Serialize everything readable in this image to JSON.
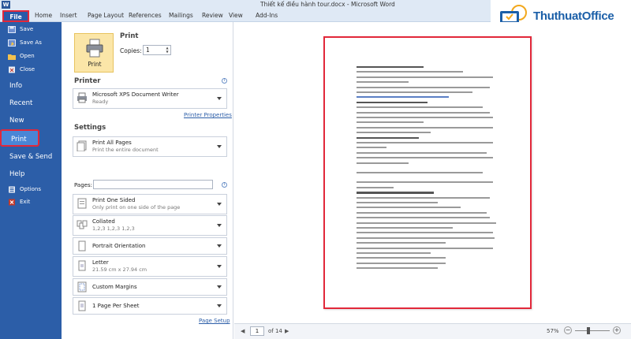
{
  "window": {
    "title": "Thiết kế điều hành tour.docx - Microsoft Word",
    "app_icon": "W"
  },
  "ribbon": {
    "file_tab": "File",
    "tabs": [
      "Home",
      "Insert",
      "Page Layout",
      "References",
      "Mailings",
      "Review",
      "View",
      "Add-Ins"
    ]
  },
  "logo": {
    "title": "ThuthuatOffice",
    "subtitle": "TRÍ KỶ CỦA DÂN CÔNG SỞ"
  },
  "file_menu": {
    "save": "Save",
    "save_as": "Save As",
    "open": "Open",
    "close": "Close",
    "info": "Info",
    "recent": "Recent",
    "new": "New",
    "print": "Print",
    "save_send": "Save & Send",
    "help": "Help",
    "options": "Options",
    "exit": "Exit"
  },
  "print_panel": {
    "heading": "Print",
    "print_button": "Print",
    "copies_label": "Copies:",
    "copies_value": "1",
    "printer_heading": "Printer",
    "printer_name": "Microsoft XPS Document Writer",
    "printer_status": "Ready",
    "printer_properties": "Printer Properties",
    "settings_heading": "Settings",
    "print_all_title": "Print All Pages",
    "print_all_sub": "Print the entire document",
    "pages_label": "Pages:",
    "one_sided_title": "Print One Sided",
    "one_sided_sub": "Only print on one side of the page",
    "collated_title": "Collated",
    "collated_sub": "1,2,3    1,2,3    1,2,3",
    "orientation": "Portrait Orientation",
    "paper_title": "Letter",
    "paper_sub": "21.59 cm x 27.94 cm",
    "margins": "Custom Margins",
    "pages_per_sheet": "1 Page Per Sheet",
    "page_setup": "Page Setup"
  },
  "preview_nav": {
    "current_page": "1",
    "of_pages": "of 14",
    "zoom": "57%",
    "zoom_level": 0.57
  },
  "colors": {
    "file_menu_bg": "#2c5ea8",
    "highlight_red": "#e2283a",
    "print_button_bg": "#fbe6a8"
  }
}
